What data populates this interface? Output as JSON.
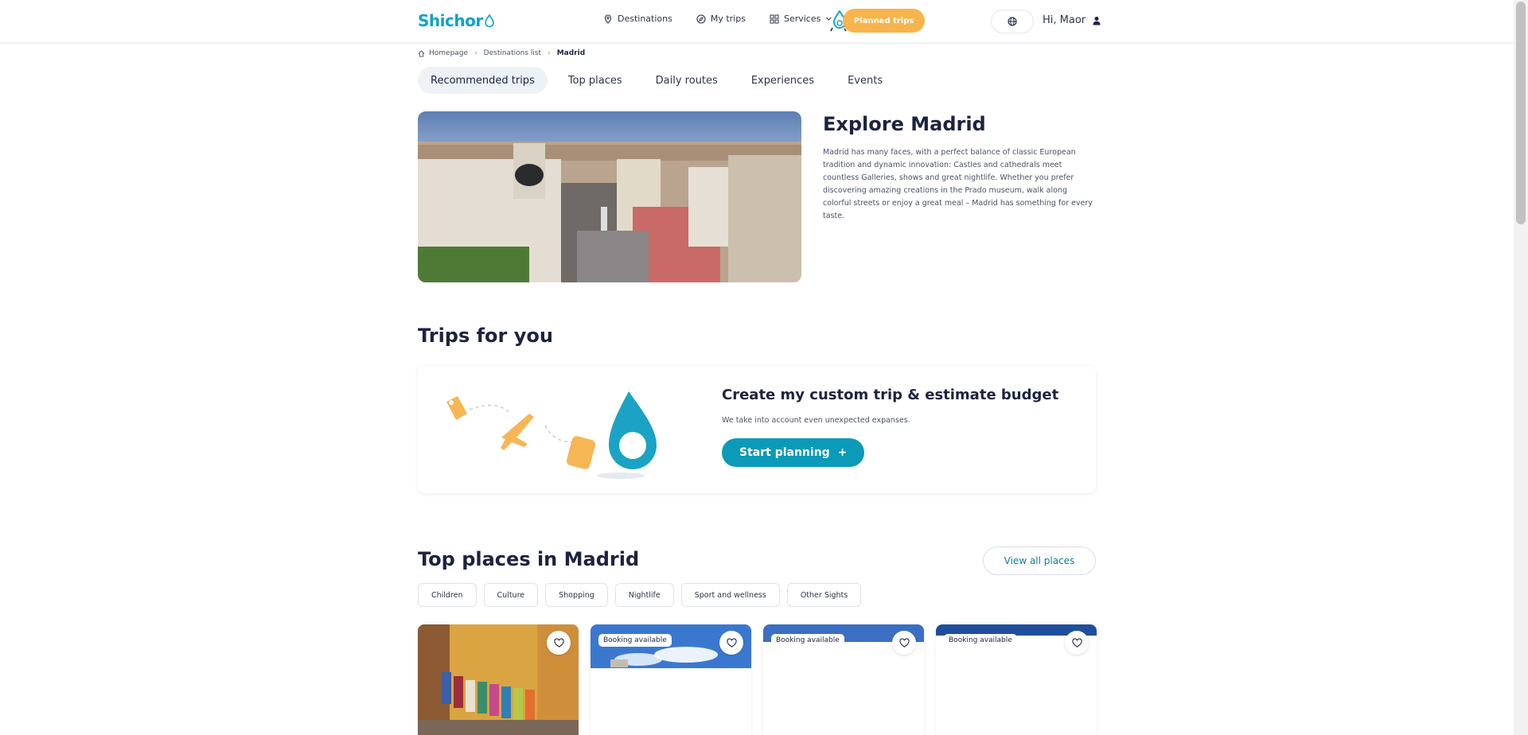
{
  "header": {
    "logo": "Shichor",
    "nav": [
      {
        "label": "Destinations",
        "icon": "location-pin-icon"
      },
      {
        "label": "My trips",
        "icon": "compass-icon"
      },
      {
        "label": "Services",
        "icon": "grid-icon"
      }
    ],
    "planned_trips_label": "Planned trips",
    "greeting": "Hi, Maor"
  },
  "breadcrumb": {
    "home": "Homepage",
    "list": "Destinations list",
    "current": "Madrid"
  },
  "tabs": [
    "Recommended trips",
    "Top places",
    "Daily routes",
    "Experiences",
    "Events"
  ],
  "hero": {
    "title": "Explore Madrid",
    "description": "Madrid has many faces, with a perfect balance of classic European tradition and dynamic innovation: Castles and cathedrals meet countless Galleries, shows and great nightlife. Whether you prefer discovering amazing creations in the Prado museum, walk along colorful streets or enjoy a great meal – Madrid has something for every taste."
  },
  "trips": {
    "section_title": "Trips for you",
    "card_title": "Create my custom trip & estimate budget",
    "card_subtitle": "We take into account even unexpected expanses.",
    "button_label": "Start planning",
    "button_symbol": "+"
  },
  "places": {
    "section_title": "Top places in Madrid",
    "view_all_label": "View all places",
    "chips": [
      "Children",
      "Culture",
      "Shopping",
      "Nightlife",
      "Sport and wellness",
      "Other Sights"
    ],
    "cards": [
      {
        "badge": ""
      },
      {
        "badge": "Booking available"
      },
      {
        "badge": "Booking available"
      },
      {
        "badge": "Booking available"
      }
    ]
  },
  "colors": {
    "brand": "#0fa3c3",
    "accent_orange": "#f7b44d",
    "button_teal": "#0b9ab8",
    "text_dark": "#1c2340"
  }
}
